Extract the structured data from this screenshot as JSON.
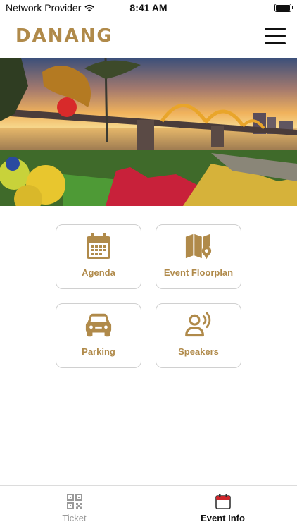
{
  "status_bar": {
    "carrier": "Network Provider",
    "time": "8:41 AM"
  },
  "header": {
    "brand": "DANANG"
  },
  "hero": {
    "icon": "dragon-bridge-photo"
  },
  "tiles": [
    {
      "label": "Agenda",
      "icon": "calendar-icon"
    },
    {
      "label": "Event Floorplan",
      "icon": "map-pin-icon"
    },
    {
      "label": "Parking",
      "icon": "car-icon"
    },
    {
      "label": "Speakers",
      "icon": "speaker-icon"
    }
  ],
  "tab_bar": {
    "tabs": [
      {
        "label": "Ticket",
        "icon": "qr-code-icon",
        "active": false
      },
      {
        "label": "Event Info",
        "icon": "calendar-icon",
        "active": true
      }
    ]
  },
  "colors": {
    "accent": "#b08a4a",
    "active_tab_icon": "#d0262c"
  }
}
